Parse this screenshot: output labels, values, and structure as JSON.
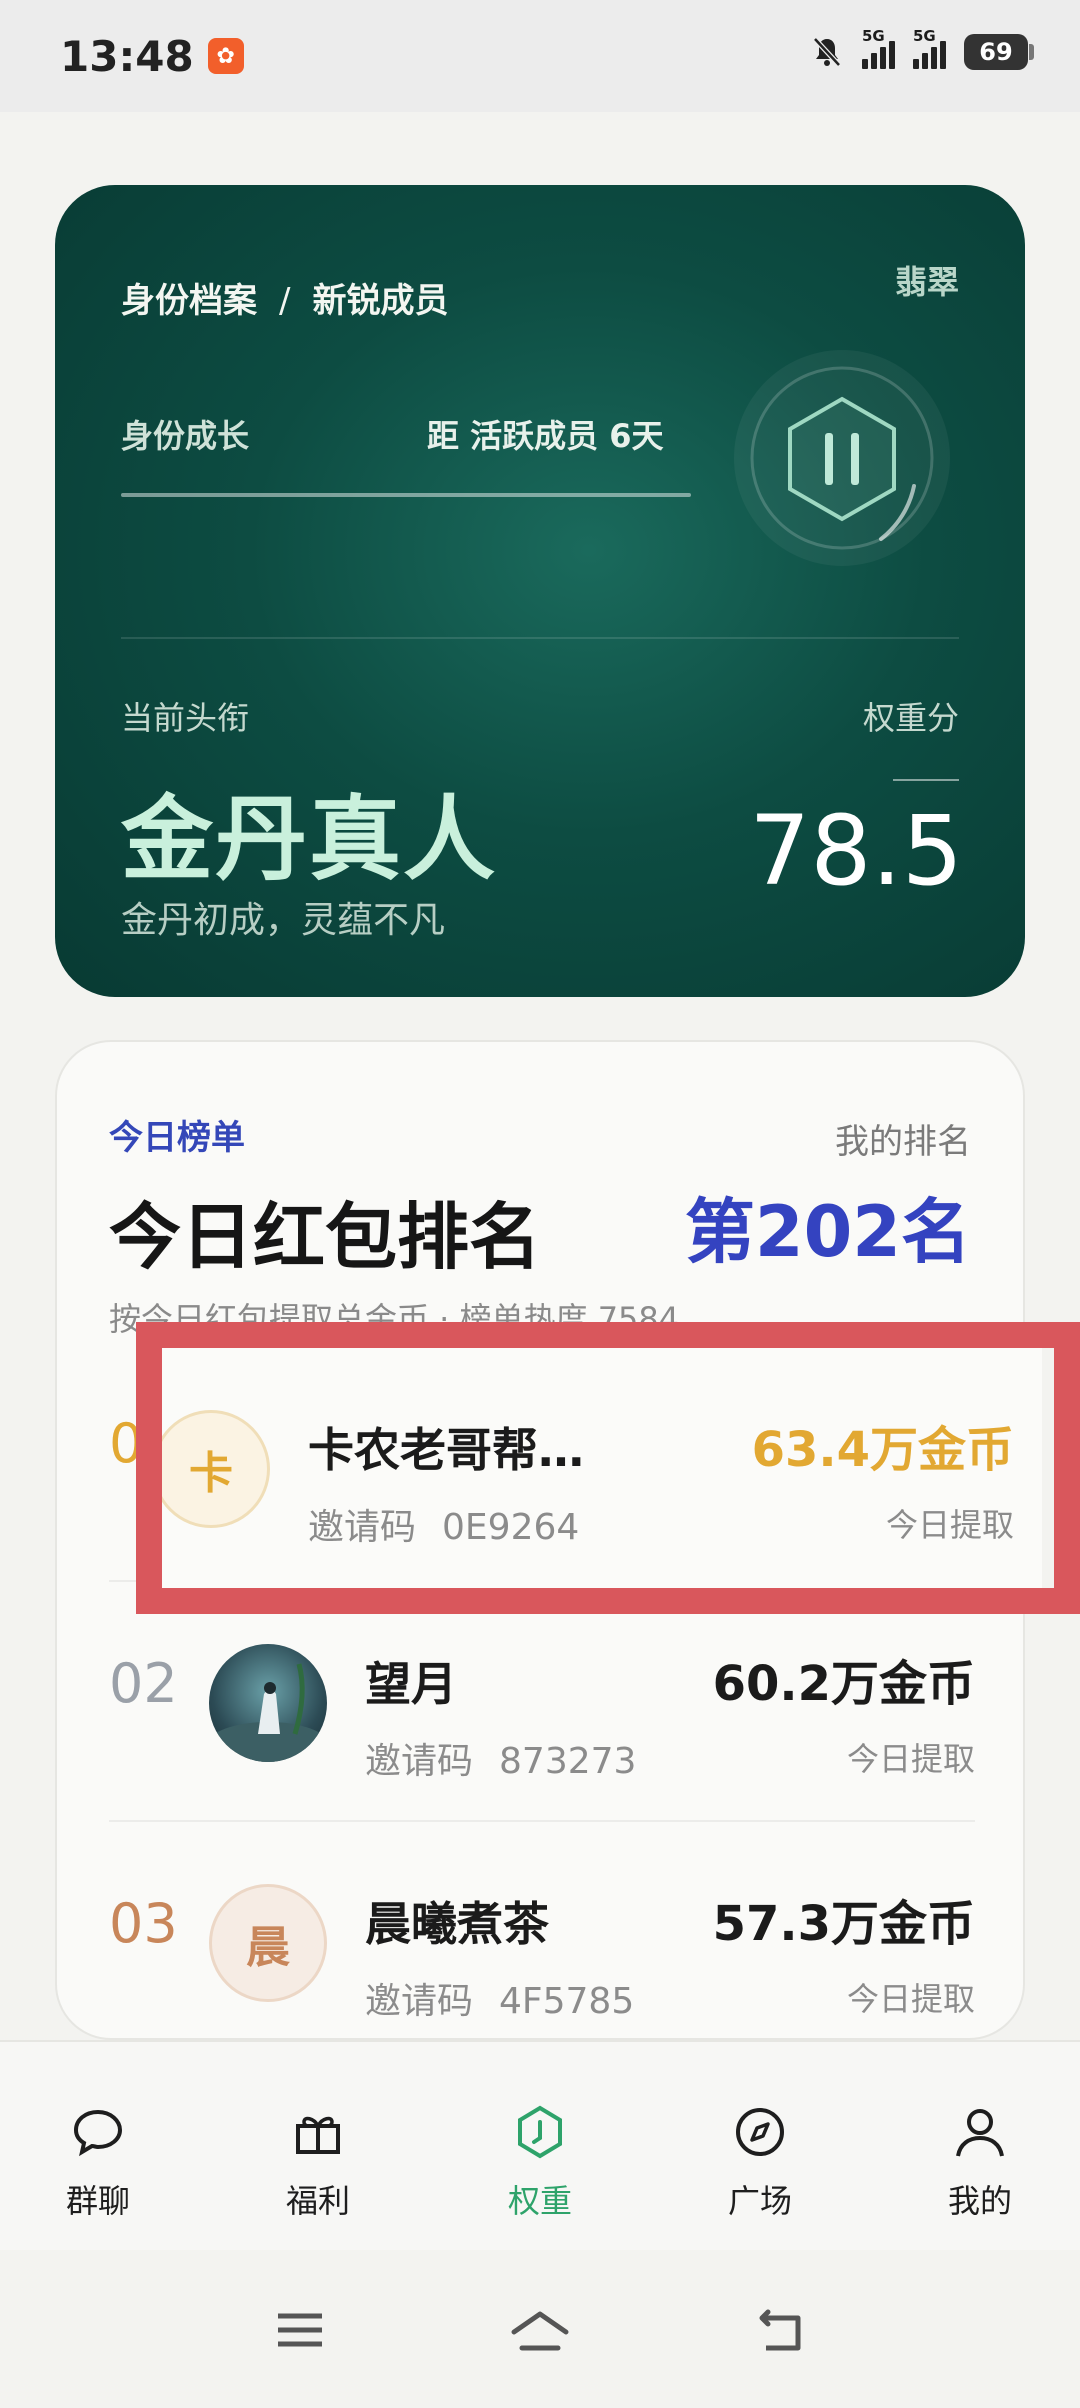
{
  "status_bar": {
    "time": "13:48",
    "signal1_label": "5G",
    "signal2_label": "5G",
    "battery": "69"
  },
  "identity_card": {
    "breadcrumb_left": "身份档案",
    "breadcrumb_sep": "/",
    "breadcrumb_right": "新锐成员",
    "tier_label": "翡翠",
    "growth_label": "身份成长",
    "next_level_text": "距 活跃成员 6天",
    "current_title_label": "当前头衔",
    "current_title": "金丹真人",
    "title_motto": "金丹初成，灵蕴不凡",
    "weight_label": "权重分",
    "weight_value": "78.5",
    "badge_icon": "hexagon-pause-badge-icon",
    "colors": {
      "card_dark": "#083a33",
      "card_mid": "#1a6a5c",
      "title_text": "#c9f0dc"
    }
  },
  "leaderboard": {
    "tag": "今日榜单",
    "my_rank_label": "我的排名",
    "heading": "今日红包排名",
    "my_rank_value": "第202名",
    "description": "按今日红包提取总金币 · 榜单热度 7584",
    "rows": [
      {
        "no": "01",
        "avatar_text": "卡",
        "name": "卡农老哥帮…",
        "code_label": "邀请码",
        "code": "0E9264",
        "amount": "63.4万金币",
        "today": "今日提取"
      },
      {
        "no": "02",
        "avatar_text": "",
        "name": "望月",
        "code_label": "邀请码",
        "code": "873273",
        "amount": "60.2万金币",
        "today": "今日提取"
      },
      {
        "no": "03",
        "avatar_text": "晨",
        "name": "晨曦煮茶",
        "code_label": "邀请码",
        "code": "4F5785",
        "amount": "57.3万金币",
        "today": "今日提取"
      }
    ],
    "colors": {
      "accent": "#3443c0",
      "gold": "#e2a832",
      "bronze": "#c8865a",
      "highlight_box": "#d9575c"
    }
  },
  "bottom_nav": {
    "items": [
      {
        "label": "群聊",
        "icon": "chat-bubble-icon"
      },
      {
        "label": "福利",
        "icon": "gift-icon"
      },
      {
        "label": "权重",
        "icon": "hexagon-weight-icon",
        "active": true
      },
      {
        "label": "广场",
        "icon": "compass-icon"
      },
      {
        "label": "我的",
        "icon": "person-icon"
      }
    ],
    "active_color": "#2ea36a"
  },
  "system_nav": {
    "icons": [
      "menu-icon",
      "home-icon",
      "back-icon"
    ]
  }
}
